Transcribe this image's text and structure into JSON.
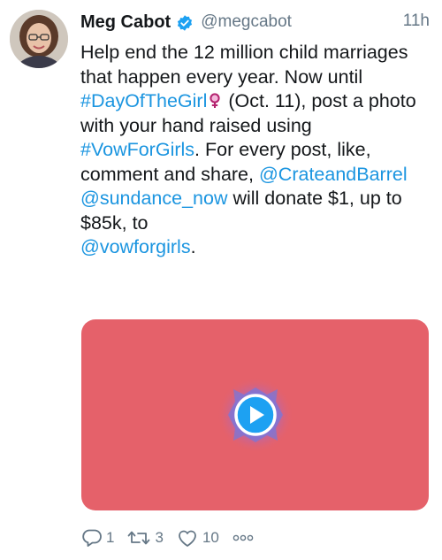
{
  "tweet": {
    "author_name": "Meg Cabot",
    "handle": "@megcabot",
    "time": "11h",
    "verified": true,
    "text": {
      "t1": "Help end the 12 million child marriages that happen every year. Now until ",
      "hashtag1": "#DayOfTheGirl",
      "t2": " (Oct. 11), post a photo with your hand raised using ",
      "hashtag2": "#VowForGirls",
      "t3": ". For every post, like, comment and share, ",
      "mention1": "@CrateandBarrel",
      "t4": " ",
      "mention2": "@sundance_now",
      "t5": " will donate $1, up to $85k, to ",
      "mention3": "@vowforgirls",
      "t6": "."
    },
    "media": {
      "type": "video",
      "background_color": "#e5616a"
    },
    "actions": {
      "replies": "1",
      "retweets": "3",
      "likes": "10"
    }
  },
  "icons": {
    "verified": "verified-badge-icon",
    "hashtag_emoji": "female-sign-icon",
    "play": "play-icon",
    "reply": "reply-icon",
    "retweet": "retweet-icon",
    "like": "heart-icon",
    "more": "more-icon"
  },
  "colors": {
    "link": "#1b95e0",
    "muted": "#657786",
    "verified": "#1da1f2"
  }
}
